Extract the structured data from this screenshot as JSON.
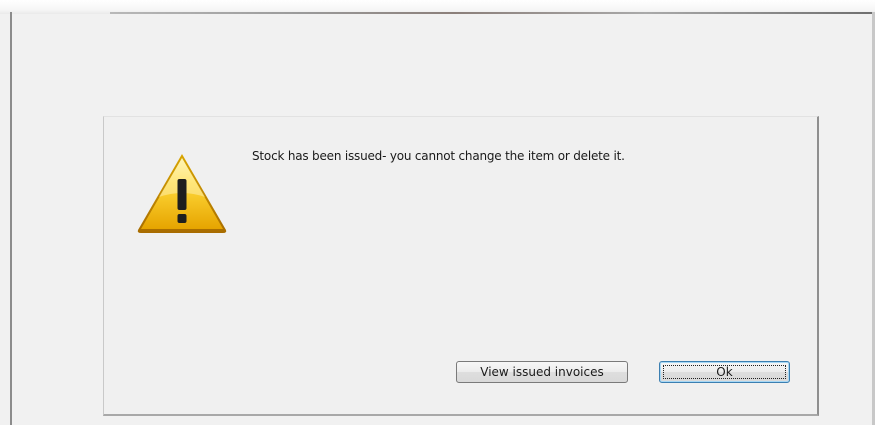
{
  "dialog": {
    "icon": "warning-icon",
    "message": "Stock has been issued- you cannot change the item or delete it.",
    "buttons": {
      "view_issued_invoices": "View issued invoices",
      "ok": "Ok"
    }
  },
  "colors": {
    "warning_yellow": "#f2c200",
    "warning_dark": "#c58a00",
    "dialog_bg": "#f0f0f0",
    "ok_focus_border": "#3c7fb1"
  }
}
